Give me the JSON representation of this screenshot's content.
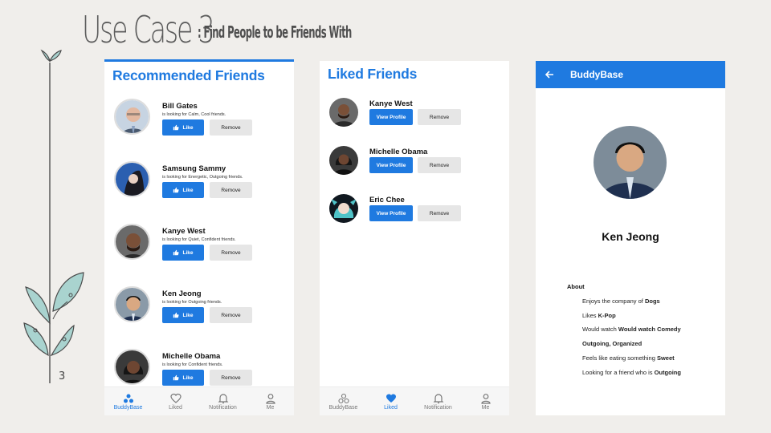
{
  "slide": {
    "title_main": "Use Case 3",
    "title_sub": ": Find People to be Friends With",
    "page_number": "3"
  },
  "screen1": {
    "heading": "Recommended Friends",
    "like_label": "Like",
    "remove_label": "Remove",
    "cards": [
      {
        "name": "Bill Gates",
        "desc": "is looking for Calm, Cool friends."
      },
      {
        "name": "Samsung Sammy",
        "desc": "is looking for Energetic, Outgoing friends."
      },
      {
        "name": "Kanye West",
        "desc": "is looking for Quiet, Confident friends."
      },
      {
        "name": "Ken Jeong",
        "desc": "is looking for Outgoing friends."
      },
      {
        "name": "Michelle Obama",
        "desc": "is looking for Confident friends."
      }
    ],
    "nav": [
      "BuddyBase",
      "Liked",
      "Notification",
      "Me"
    ],
    "active_nav": "BuddyBase"
  },
  "screen2": {
    "heading": "Liked Friends",
    "view_label": "View Profile",
    "remove_label": "Remove",
    "cards": [
      {
        "name": "Kanye West"
      },
      {
        "name": "Michelle Obama"
      },
      {
        "name": "Eric Chee"
      }
    ],
    "nav": [
      "BuddyBase",
      "Liked",
      "Notification",
      "Me"
    ],
    "active_nav": "Liked"
  },
  "screen3": {
    "appbar_title": "BuddyBase",
    "profile_name": "Ken Jeong",
    "about_label": "About",
    "about": {
      "company_prefix": "Enjoys the company of ",
      "company_value": "Dogs",
      "likes_prefix": "Likes ",
      "likes_value": "K-Pop",
      "watch_prefix": "Would watch ",
      "watch_value": "Would watch Comedy",
      "traits": "Outgoing, Organized",
      "food_prefix": "Feels like eating something ",
      "food_value": "Sweet",
      "looking_prefix": "Looking for a friend who is ",
      "looking_value": "Outgoing"
    }
  },
  "colors": {
    "accent": "#1f7ae0",
    "background": "#f0eeeb",
    "leaf": "#a9d3cf",
    "button_gray": "#e6e6e6"
  },
  "icons": [
    "thumbs-up-icon",
    "buddybase-icon",
    "heart-icon",
    "bell-icon",
    "person-icon",
    "back-arrow-icon"
  ]
}
